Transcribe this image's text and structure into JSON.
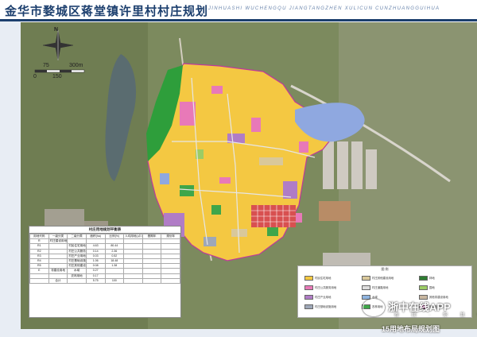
{
  "title": "金华市婺城区蒋堂镇许里村村庄规划",
  "subtitle": "JINHUASHI WUCHENGQU JIANGTANGZHEN XULICUN CUNZHUANGGUIHUA",
  "compass": {
    "north_label": "N"
  },
  "scale": {
    "label_75": "75",
    "label_300": "300m",
    "label_0": "0",
    "label_150": "150"
  },
  "table": {
    "title": "村庄用地规划平衡表",
    "headers": [
      "用地代码",
      "一级分类",
      "二级分类",
      "面积(ha)",
      "比例(%)",
      "人均用地(㎡/人)",
      "基期年",
      "规划年"
    ],
    "rows": [
      [
        "R",
        "村庄建设用地",
        "",
        "",
        "",
        "",
        "",
        ""
      ],
      [
        "R1",
        "",
        "村民住宅用地",
        "4.63",
        "80.44",
        "",
        "",
        ""
      ],
      [
        "R2",
        "",
        "村庄公共服务用地",
        "0.14",
        "2.36",
        "",
        "",
        ""
      ],
      [
        "R3",
        "",
        "村庄产业用地",
        "0.03",
        "0.52",
        "",
        "",
        ""
      ],
      [
        "R4",
        "",
        "村庄基础设施用地",
        "1.06",
        "18.48",
        "",
        "",
        ""
      ],
      [
        "R5",
        "",
        "村庄其他建设用地",
        "0.08",
        "1.38",
        "",
        "",
        ""
      ],
      [
        "E",
        "非建设用地",
        "水域",
        "0.27",
        "",
        "",
        "",
        ""
      ],
      [
        "",
        "",
        "农林用地",
        "0.17",
        "",
        "",
        "",
        ""
      ],
      [
        "",
        "合计",
        "",
        "5.75",
        "100",
        "",
        "",
        ""
      ]
    ]
  },
  "legend": {
    "title": "图    例",
    "items": [
      {
        "label": "村民住宅用地",
        "color": "#f4c842"
      },
      {
        "label": "村庄公共服务用地",
        "color": "#e879b8"
      },
      {
        "label": "村庄产业用地",
        "color": "#b07cc6"
      },
      {
        "label": "村庄基础设施用地",
        "color": "#9ea7b8"
      },
      {
        "label": "村庄其他建设用地",
        "color": "#d9c89a"
      },
      {
        "label": "村庄道路用地",
        "color": "#dddddd"
      },
      {
        "label": "水域",
        "color": "#8fb4e0"
      },
      {
        "label": "农林用地",
        "color": "#3fa64a"
      },
      {
        "label": "林地",
        "color": "#2e7d32"
      },
      {
        "label": "园地",
        "color": "#9ccc65"
      },
      {
        "label": "其他非建设用地",
        "color": "#c8b6a0"
      },
      {
        "label": "规划范围线",
        "color": "#c0399a"
      }
    ]
  },
  "watermark": {
    "main": "浙中在线APP",
    "sub": "新 闻 · 你 我 他"
  },
  "credit": "15用地布局规划图"
}
